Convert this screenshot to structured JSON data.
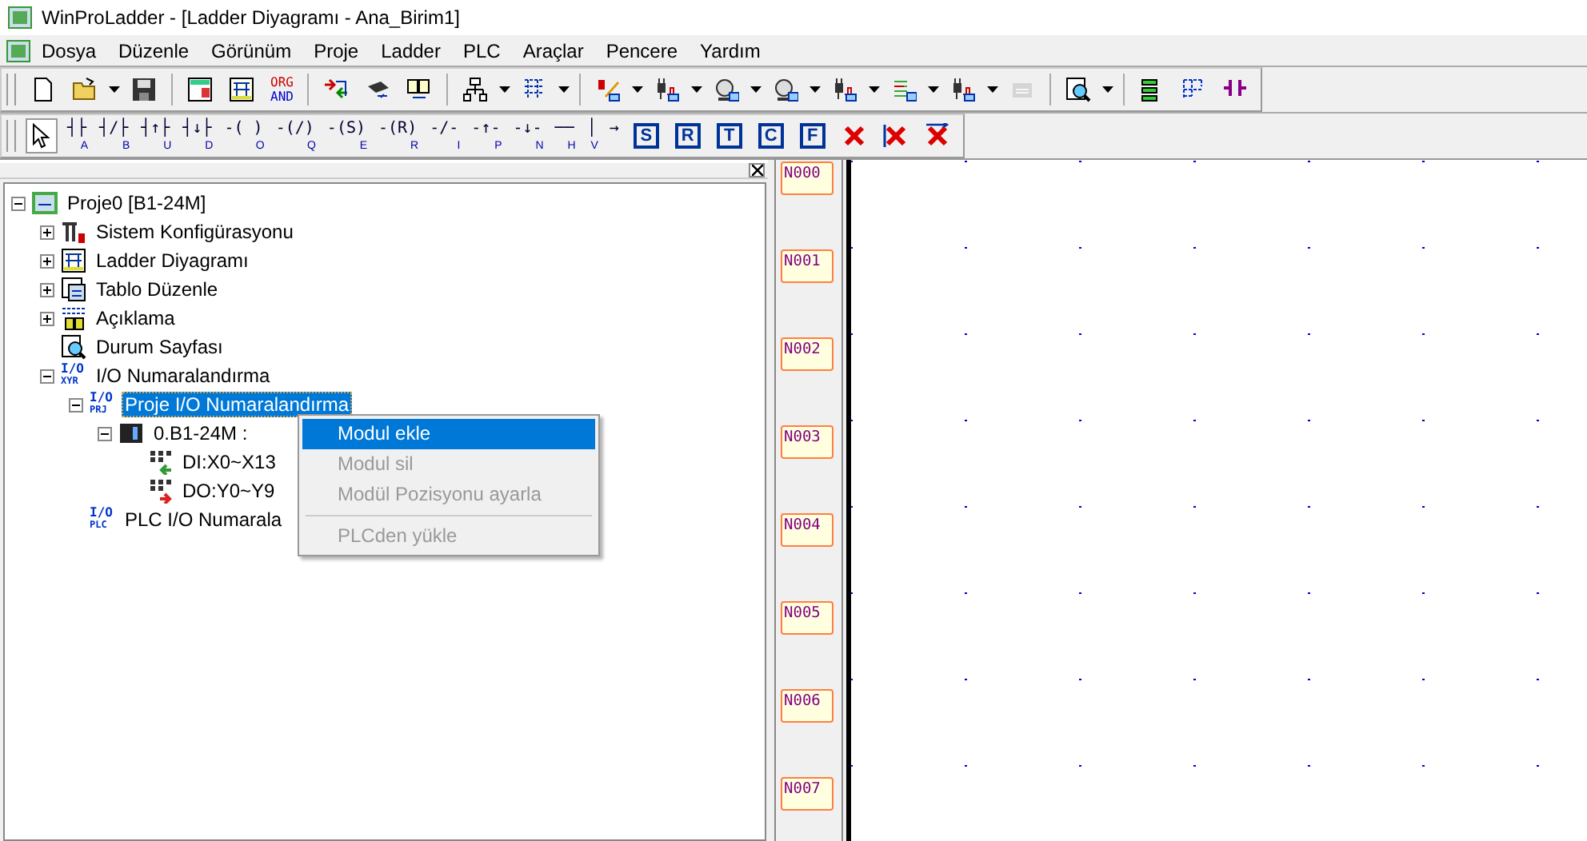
{
  "window": {
    "title": "WinProLadder - [Ladder Diyagramı - Ana_Birim1]"
  },
  "menu": [
    "Dosya",
    "Düzenle",
    "Görünüm",
    "Proje",
    "Ladder",
    "PLC",
    "Araçlar",
    "Pencere",
    "Yardım"
  ],
  "toolbar_1": [
    {
      "kind": "new",
      "dropdown": false,
      "disabled": false
    },
    {
      "kind": "open",
      "dropdown": true,
      "disabled": false
    },
    {
      "kind": "save",
      "dropdown": false,
      "disabled": false
    },
    {
      "kind": "separator"
    },
    {
      "kind": "table",
      "dropdown": false,
      "disabled": false
    },
    {
      "kind": "ladder",
      "dropdown": false,
      "disabled": false
    },
    {
      "kind": "text",
      "label": "ORG",
      "label_2": "AND",
      "dropdown": false,
      "disabled": false
    },
    {
      "kind": "separator"
    },
    {
      "kind": "transfer",
      "dropdown": false,
      "disabled": false
    },
    {
      "kind": "chip",
      "dropdown": false,
      "disabled": false
    },
    {
      "kind": "book",
      "dropdown": false,
      "disabled": false
    },
    {
      "kind": "separator"
    },
    {
      "kind": "tree",
      "dropdown": true,
      "disabled": false
    },
    {
      "kind": "grid",
      "dropdown": true,
      "disabled": false
    },
    {
      "kind": "separator"
    },
    {
      "kind": "pen",
      "dropdown": true,
      "disabled": false
    },
    {
      "kind": "plug",
      "dropdown": true,
      "disabled": false
    },
    {
      "kind": "motor",
      "dropdown": true,
      "disabled": false
    },
    {
      "kind": "motor",
      "dropdown": true,
      "disabled": false
    },
    {
      "kind": "plug",
      "dropdown": true,
      "disabled": false
    },
    {
      "kind": "list",
      "dropdown": true,
      "disabled": false
    },
    {
      "kind": "plug",
      "dropdown": true,
      "disabled": false
    },
    {
      "kind": "monitor",
      "dropdown": false,
      "disabled": true
    },
    {
      "kind": "separator"
    },
    {
      "kind": "zoom",
      "dropdown": true,
      "disabled": false
    },
    {
      "kind": "separator"
    },
    {
      "kind": "stack",
      "dropdown": false,
      "disabled": false
    },
    {
      "kind": "network",
      "dropdown": false,
      "disabled": false
    },
    {
      "kind": "contact",
      "dropdown": false,
      "disabled": false
    }
  ],
  "toolbar_2": [
    {
      "kind": "pointer",
      "selected": true
    },
    {
      "kind": "symbol",
      "symbol": "┤├",
      "key": "A",
      "selected": false
    },
    {
      "kind": "symbol",
      "symbol": "┤/├",
      "key": "B",
      "selected": false
    },
    {
      "kind": "symbol",
      "symbol": "┤↑├",
      "key": "U",
      "selected": false
    },
    {
      "kind": "symbol",
      "symbol": "┤↓├",
      "key": "D",
      "selected": false
    },
    {
      "kind": "symbol",
      "symbol": "-( )",
      "key": "O",
      "selected": false
    },
    {
      "kind": "symbol",
      "symbol": "-(/)",
      "key": "Q",
      "selected": false
    },
    {
      "kind": "symbol",
      "symbol": "-(S)",
      "key": "E",
      "selected": false
    },
    {
      "kind": "symbol",
      "symbol": "-(R)",
      "key": "R",
      "selected": false
    },
    {
      "kind": "symbol",
      "symbol": "-/-",
      "key": "I",
      "selected": false
    },
    {
      "kind": "symbol",
      "symbol": "-↑-",
      "key": "P",
      "selected": false
    },
    {
      "kind": "symbol",
      "symbol": "-↓-",
      "key": "N",
      "selected": false
    },
    {
      "kind": "symbol",
      "symbol": "──",
      "key": "H",
      "selected": false
    },
    {
      "kind": "symbol",
      "symbol": "│",
      "key": "V",
      "selected": false
    },
    {
      "kind": "symbol",
      "symbol": "→",
      "selected": false
    },
    {
      "kind": "letter",
      "label": "S",
      "selected": false
    },
    {
      "kind": "letter",
      "label": "R",
      "selected": false
    },
    {
      "kind": "letter",
      "label": "T",
      "selected": false
    },
    {
      "kind": "letter",
      "label": "C",
      "selected": false
    },
    {
      "kind": "letter",
      "label": "F",
      "selected": false
    },
    {
      "kind": "delete",
      "selected": false
    },
    {
      "kind": "delete-vertical",
      "selected": false
    },
    {
      "kind": "delete-row",
      "selected": false
    }
  ],
  "tree": [
    {
      "label": "Proje0 [B1-24M]",
      "kind": "project",
      "expanded": true,
      "selected": false,
      "children": [
        {
          "label": "Sistem Konfigürasyonu",
          "kind": "tools",
          "expanded": false,
          "selected": false
        },
        {
          "label": "Ladder Diyagramı",
          "kind": "ladder",
          "expanded": false,
          "selected": false
        },
        {
          "label": "Tablo Düzenle",
          "kind": "table",
          "expanded": false,
          "selected": false
        },
        {
          "label": "Açıklama",
          "kind": "comment",
          "expanded": false,
          "selected": false
        },
        {
          "label": "Durum Sayfası",
          "kind": "status",
          "selected": false
        },
        {
          "label": "I/O Numaralandırma",
          "kind": "io",
          "badge": "I/O",
          "badge_2": "XYR",
          "expanded": true,
          "selected": false,
          "children": [
            {
              "label": "Proje I/O Numaralandırma",
              "kind": "io",
              "badge": "I/O",
              "badge_2": "PRJ",
              "expanded": true,
              "selected": true,
              "children": [
                {
                  "label": "0.B1-24M :",
                  "kind": "plc",
                  "expanded": true,
                  "selected": false,
                  "children": [
                    {
                      "label": "DI:X0~X13",
                      "kind": "input",
                      "selected": false
                    },
                    {
                      "label": "DO:Y0~Y9",
                      "kind": "output",
                      "selected": false
                    }
                  ]
                }
              ]
            },
            {
              "label": "PLC I/O Numarala",
              "kind": "io",
              "badge": "I/O",
              "badge_2": "PLC",
              "selected": false
            }
          ]
        }
      ]
    }
  ],
  "context_menu": [
    {
      "label": "Modul ekle",
      "selected": true,
      "disabled": false
    },
    {
      "label": "Modul sil",
      "selected": false,
      "disabled": true
    },
    {
      "label": "Modül Pozisyonu ayarla",
      "selected": false,
      "disabled": true
    },
    {
      "kind": "separator"
    },
    {
      "label": "PLCden yükle",
      "selected": false,
      "disabled": true
    }
  ],
  "rungs": [
    "N000",
    "N001",
    "N002",
    "N003",
    "N004",
    "N005",
    "N006",
    "N007"
  ]
}
